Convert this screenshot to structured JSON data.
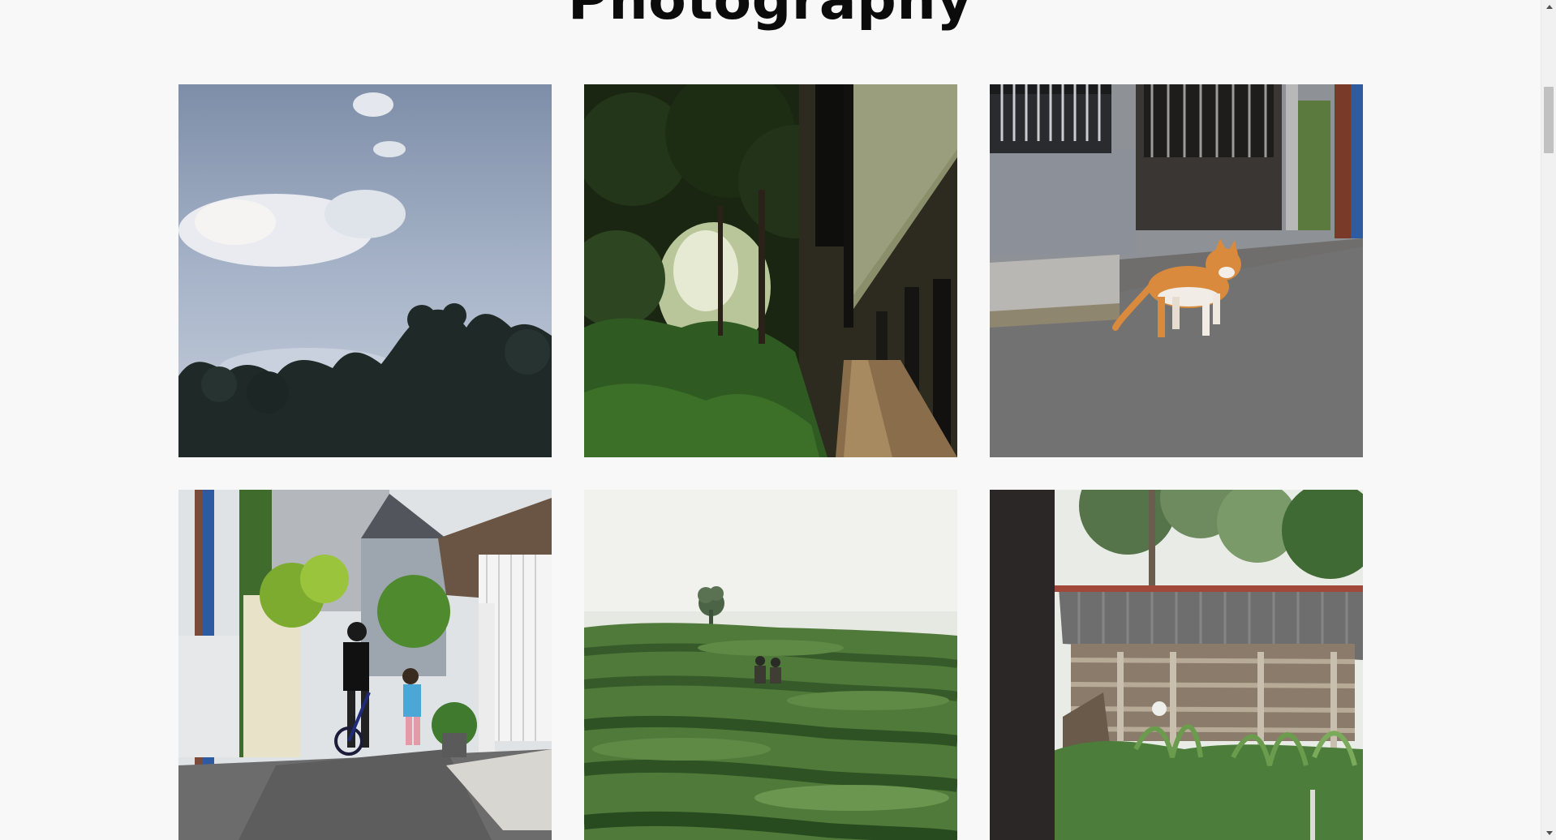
{
  "page": {
    "title": "Photography"
  },
  "gallery": {
    "photos": [
      {
        "subject": "cloudy-sky-over-trees"
      },
      {
        "subject": "forest-path-beside-building"
      },
      {
        "subject": "orange-cat-walking-on-road"
      },
      {
        "subject": "children-with-bicycle-in-alley"
      },
      {
        "subject": "people-in-tea-plantation"
      },
      {
        "subject": "wooden-shed-with-tin-roof"
      }
    ]
  },
  "colors": {
    "background": "#f8f8f8",
    "title": "#0b0b0b",
    "scrollbar_track": "#f1f1f1",
    "scrollbar_thumb": "#c1c1c1"
  }
}
